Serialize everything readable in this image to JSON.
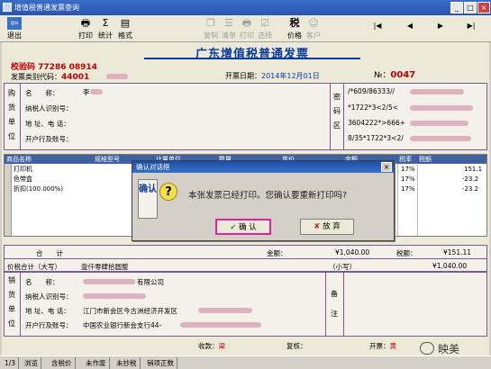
{
  "window": {
    "title": "增值税普通发票查询",
    "min": "_",
    "max": "□",
    "close": "×"
  },
  "toolbar": {
    "exit": "退出",
    "print": "打印",
    "stats": "统计",
    "format": "格式",
    "d1": "复制",
    "d2": "清单",
    "d3": "打印",
    "d4": "选择",
    "price": "价格",
    "d5": "客户",
    "nav": [
      "|◀",
      "◀",
      "▶",
      "▶|"
    ]
  },
  "invoice": {
    "title": "广东增值税普通发票",
    "check_code_label": "校验码",
    "check_code": "77286 08914",
    "category_label": "发票类别代码：",
    "category_code": "44001",
    "date_label": "开票日期：",
    "date": "2014年12月01日",
    "no_label": "№：",
    "no_value": "0047",
    "buyer": {
      "side": [
        "购",
        "货",
        "单",
        "位"
      ],
      "name_label": "名　　称：",
      "name_value": "李",
      "tax_label": "纳税人识别号：",
      "addr_label": "地 址、电 话：",
      "bank_label": "开户行及账号："
    },
    "cipher": {
      "side": [
        "密",
        "码",
        "区"
      ],
      "lines": [
        "/*609/86333//",
        "*1722*3<2/5<",
        "3604222*>666+",
        "8/35*1722*3<2/"
      ]
    },
    "items": {
      "columns": [
        "商品名称",
        "规格型号",
        "计量单位",
        "数量",
        "单价",
        "金额",
        "税率",
        "税额"
      ],
      "rows": [
        {
          "name": "打印机",
          "rate": "17%",
          "tax": "151.1"
        },
        {
          "name": "色带盒",
          "rate": "17%",
          "tax": "-23.2"
        },
        {
          "name": "折扣(100.000%)",
          "rate": "17%",
          "tax": "-23.2"
        }
      ]
    },
    "total_label": "合　　计",
    "amount_label": "金额：",
    "amount_value": "¥1,040.00",
    "taxamt_label": "税额：",
    "taxamt_value": "¥151.11",
    "price_total_label": "价税合计（大写）",
    "price_total_cn": "壹仟零肆拾圆整",
    "small_label": "（小写）",
    "small_value": "¥1,040.00",
    "seller": {
      "side": [
        "销",
        "货",
        "单",
        "位"
      ],
      "name_label": "名　　称：",
      "name_value": "有限公司",
      "tax_label": "纳税人识别号：",
      "addr_label": "地 址、电 话：",
      "addr_value": "江门市新会区今古洲经济开发区",
      "bank_label": "开户行及账号：",
      "bank_value": "中国农业银行新会支行44-"
    },
    "remark_side": [
      "备",
      "注"
    ],
    "receiver_label": "收款：",
    "receiver_value": "梁",
    "reviewer_label": "复核：",
    "drawer_label": "开票：",
    "drawer_value": "黄"
  },
  "dialog": {
    "title": "确认对话框",
    "side": "确认",
    "message": "本张发票已经打印。您确认要重新打印吗?",
    "ok": "确 认",
    "cancel": "放 弃",
    "close": "×"
  },
  "statusbar": {
    "page": "1/3",
    "items": [
      "浏览",
      "含税价",
      "未作废",
      "未抄税",
      "销项正数"
    ]
  },
  "watermark": "映美"
}
